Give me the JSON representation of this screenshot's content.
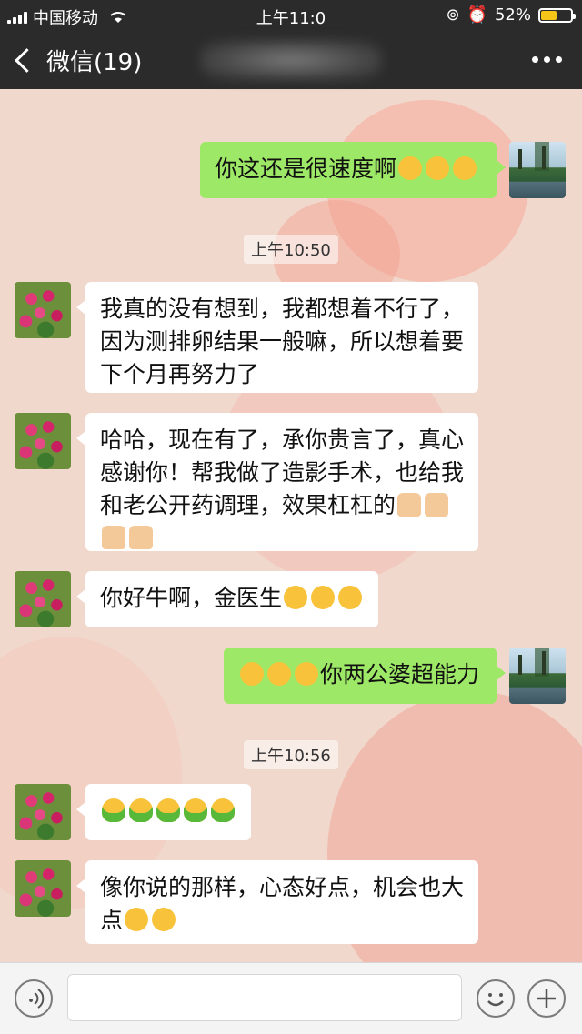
{
  "status_bar": {
    "carrier": "中国移动",
    "time": "上午11:0",
    "battery": "52%",
    "battery_level": 0.52
  },
  "nav": {
    "back_label": "微信(19)"
  },
  "colors": {
    "out_bubble": "#9de866",
    "in_bubble": "#ffffff",
    "bar": "#2b2b2b"
  },
  "messages": [
    {
      "from": "me",
      "text": "你这还是很速度啊",
      "emoji": [
        "facepalm",
        "facepalm",
        "facepalm"
      ]
    },
    {
      "type": "timestamp",
      "text": "上午10:50"
    },
    {
      "from": "other",
      "text": "我真的没有想到，我都想着不行了，因为测排卵结果一般嘛，所以想着要下个月再努力了"
    },
    {
      "from": "other",
      "text": "哈哈，现在有了，承你贵言了，真心感谢你！帮我做了造影手术，也给我和老公开药调理，效果杠杠的",
      "emoji": [
        "thumbs-up",
        "thumbs-up",
        "thumbs-up",
        "thumbs-up"
      ]
    },
    {
      "from": "other",
      "text": "你好牛啊，金医生",
      "emoji": [
        "kiss",
        "grin",
        "kiss"
      ]
    },
    {
      "from": "me",
      "text": "你两公婆超能力",
      "emoji": [
        "smile",
        "smile",
        "smile"
      ]
    },
    {
      "type": "timestamp",
      "text": "上午10:56"
    },
    {
      "from": "other",
      "text": "",
      "emoji": [
        "green-figure",
        "green-figure",
        "green-figure",
        "green-figure",
        "green-figure"
      ]
    },
    {
      "from": "other",
      "text": "像你说的那样，心态好点，机会也大点",
      "emoji": [
        "kiss",
        "kiss"
      ]
    }
  ]
}
